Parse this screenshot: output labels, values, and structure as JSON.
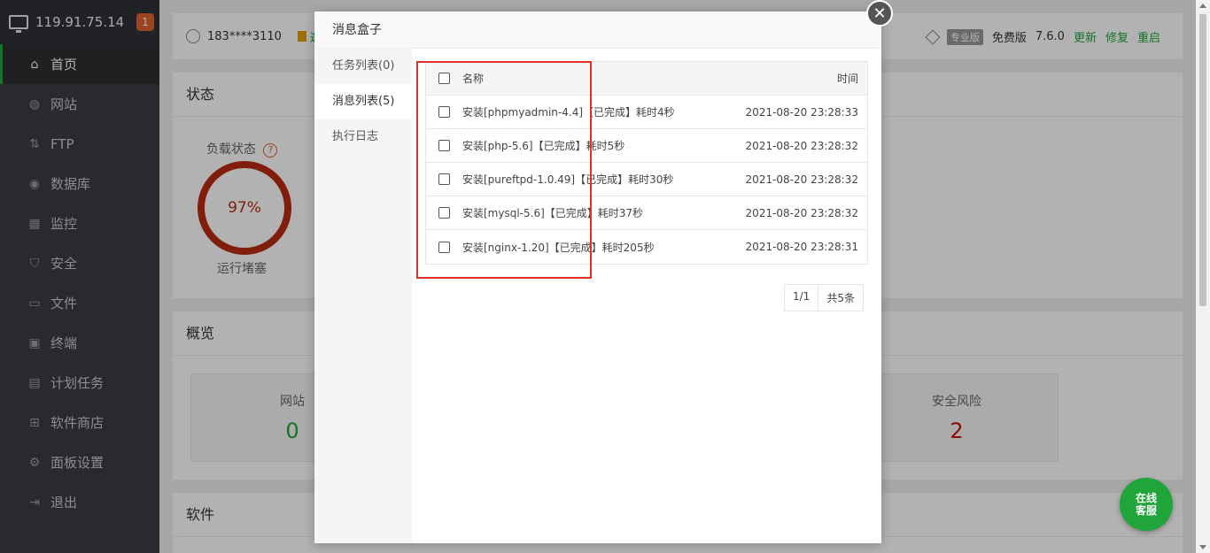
{
  "sidebar": {
    "server_ip": "119.91.75.14",
    "badge": "1",
    "items": [
      {
        "label": "首页",
        "icon": "home-icon"
      },
      {
        "label": "网站",
        "icon": "globe-icon"
      },
      {
        "label": "FTP",
        "icon": "ftp-icon"
      },
      {
        "label": "数据库",
        "icon": "database-icon"
      },
      {
        "label": "监控",
        "icon": "monitor-icon"
      },
      {
        "label": "安全",
        "icon": "shield-icon"
      },
      {
        "label": "文件",
        "icon": "folder-icon"
      },
      {
        "label": "终端",
        "icon": "terminal-icon"
      },
      {
        "label": "计划任务",
        "icon": "calendar-icon"
      },
      {
        "label": "软件商店",
        "icon": "grid-icon"
      },
      {
        "label": "面板设置",
        "icon": "gear-icon"
      },
      {
        "label": "退出",
        "icon": "logout-icon"
      }
    ]
  },
  "topbar": {
    "user": "183****3110",
    "invite": "邀",
    "pro_tag": "专业版",
    "edition": "免费版",
    "version": "7.6.0",
    "update": "更新",
    "repair": "修复",
    "restart": "重启"
  },
  "status_panel": {
    "title": "状态",
    "load_label": "负载状态",
    "help": "?",
    "load_value": "97%",
    "load_level": 0.97,
    "load_status": "运行堵塞"
  },
  "overview_panel": {
    "title": "概览",
    "sites_label": "网站",
    "sites_value": "0",
    "risk_label": "安全风险",
    "risk_value": "2"
  },
  "software_panel": {
    "title": "软件"
  },
  "modal": {
    "title": "消息盒子",
    "tabs": [
      "任务列表(0)",
      "消息列表(5)",
      "执行日志"
    ],
    "table": {
      "col_name": "名称",
      "col_time": "时间",
      "rows": [
        {
          "name": "安装[phpmyadmin-4.4]【已完成】耗时4秒",
          "time": "2021-08-20 23:28:33"
        },
        {
          "name": "安装[php-5.6]【已完成】耗时5秒",
          "time": "2021-08-20 23:28:32"
        },
        {
          "name": "安装[pureftpd-1.0.49]【已完成】耗时30秒",
          "time": "2021-08-20 23:28:32"
        },
        {
          "name": "安装[mysql-5.6]【已完成】耗时37秒",
          "time": "2021-08-20 23:28:32"
        },
        {
          "name": "安装[nginx-1.20]【已完成】耗时205秒",
          "time": "2021-08-20 23:28:31"
        }
      ]
    },
    "pager": {
      "page": "1/1",
      "total": "共5条"
    }
  },
  "chat": {
    "line1": "在线",
    "line2": "客服"
  },
  "colors": {
    "accent": "#20a53a",
    "danger": "#b82c10",
    "sidebar": "#3a3d41"
  }
}
